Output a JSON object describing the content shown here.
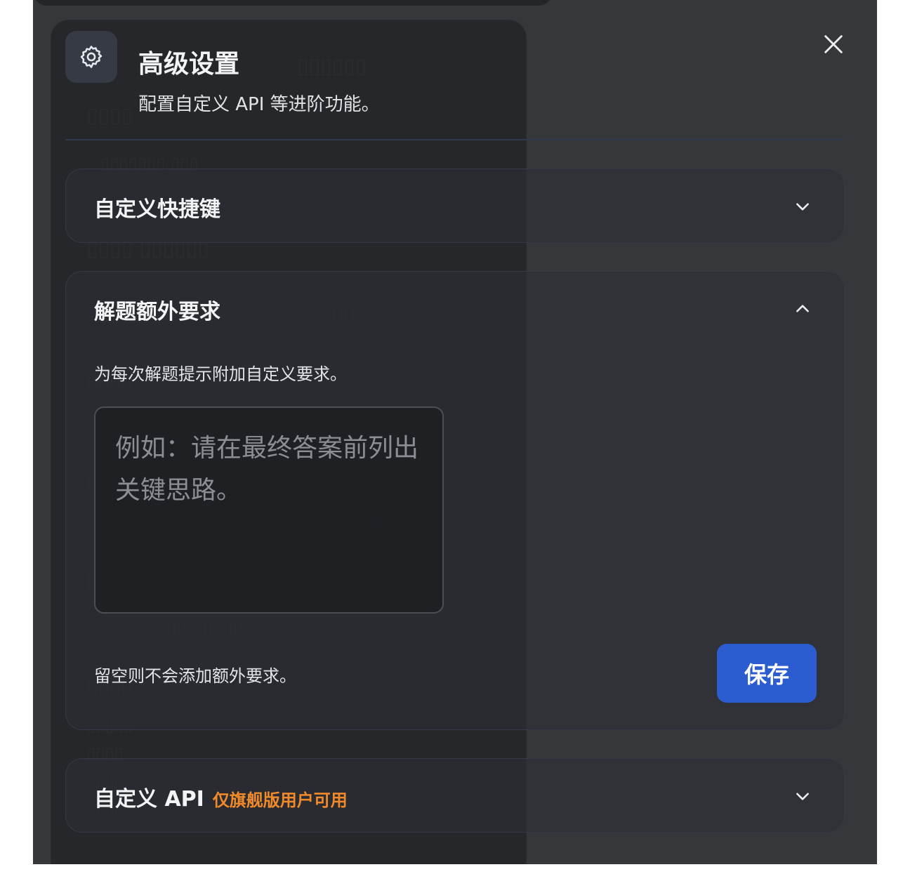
{
  "header": {
    "icon": "gear-icon",
    "title": "高级设置",
    "subtitle": "配置自定义 API 等进阶功能。",
    "close_icon": "close-icon"
  },
  "sections": {
    "shortcuts": {
      "title": "自定义快捷键",
      "expanded": false,
      "chevron": "chevron-down-icon"
    },
    "extra": {
      "title": "解题额外要求",
      "expanded": true,
      "chevron": "chevron-up-icon",
      "description": "为每次解题提示附加自定义要求。",
      "placeholder": "例如：请在最终答案前列出关键思路。",
      "value": "",
      "hint": "留空则不会添加额外要求。",
      "save_label": "保存"
    },
    "api": {
      "title": "自定义 API",
      "badge": "仅旗舰版用户可用",
      "expanded": false,
      "chevron": "chevron-down-icon"
    }
  },
  "colors": {
    "accent": "#2b5dd0",
    "badge": "#f08a2a",
    "background": "#434347",
    "panel": "#1f2024"
  }
}
